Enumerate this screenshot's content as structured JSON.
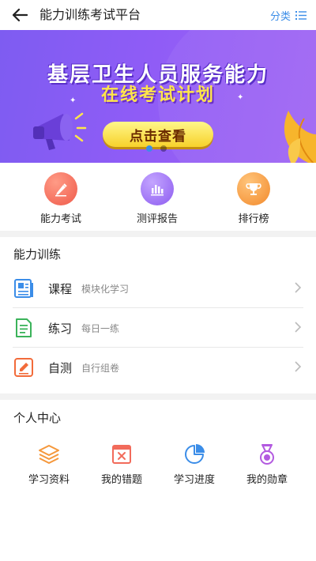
{
  "header": {
    "title": "能力训练考试平台",
    "category_label": "分类"
  },
  "banner": {
    "title": "基层卫生人员服务能力",
    "subtitle": "在线考试计划",
    "button_label": "点击查看",
    "active_slide": 1,
    "slide_count": 2
  },
  "quick_actions": [
    {
      "label": "能力考试",
      "icon": "pencil-icon",
      "color": "#f26b5b"
    },
    {
      "label": "测评报告",
      "icon": "bar-chart-icon",
      "color": "#9b6cf0"
    },
    {
      "label": "排行榜",
      "icon": "trophy-icon",
      "color": "#f5973a"
    }
  ],
  "training": {
    "title": "能力训练",
    "items": [
      {
        "title": "课程",
        "subtitle": "模块化学习",
        "icon": "book-icon",
        "color": "#3b8de8"
      },
      {
        "title": "练习",
        "subtitle": "每日一练",
        "icon": "document-icon",
        "color": "#3bb35a"
      },
      {
        "title": "自测",
        "subtitle": "自行组卷",
        "icon": "edit-icon",
        "color": "#f26b3a"
      }
    ]
  },
  "personal": {
    "title": "个人中心",
    "items": [
      {
        "label": "学习资料",
        "icon": "layers-icon",
        "color": "#f5973a"
      },
      {
        "label": "我的错题",
        "icon": "wrong-book-icon",
        "color": "#f26b5b"
      },
      {
        "label": "学习进度",
        "icon": "pie-chart-icon",
        "color": "#3b8de8"
      },
      {
        "label": "我的勋章",
        "icon": "medal-icon",
        "color": "#b35ae0"
      }
    ]
  }
}
